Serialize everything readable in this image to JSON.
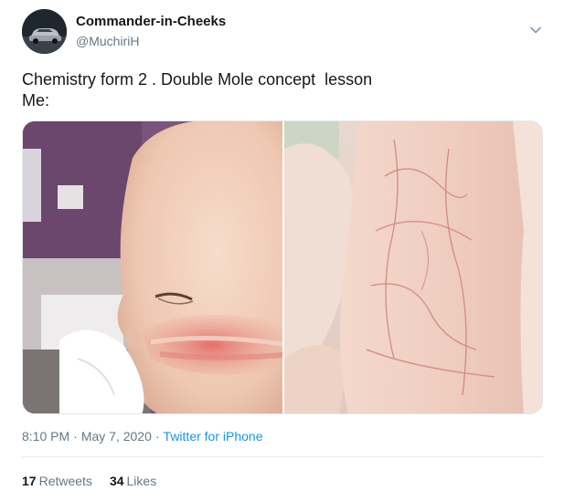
{
  "user": {
    "display_name": "Commander-in-Cheeks",
    "handle": "@MuchiriH",
    "avatar_icon": "car-avatar"
  },
  "tweet": {
    "line1": "Chemistry form 2 . Double Mole concept  lesson",
    "line2": "Me:"
  },
  "media": {
    "photos": [
      "baby-cheek-photo",
      "skin-marks-photo"
    ]
  },
  "meta": {
    "time": "8:10 PM",
    "separator": "·",
    "date": "May 7, 2020",
    "source": "Twitter for iPhone"
  },
  "stats": {
    "retweets_count": "17",
    "retweets_label": "Retweets",
    "likes_count": "34",
    "likes_label": "Likes"
  },
  "colors": {
    "link": "#1b95e0",
    "secondary_text": "#657786",
    "divider": "#e6ecf0"
  }
}
